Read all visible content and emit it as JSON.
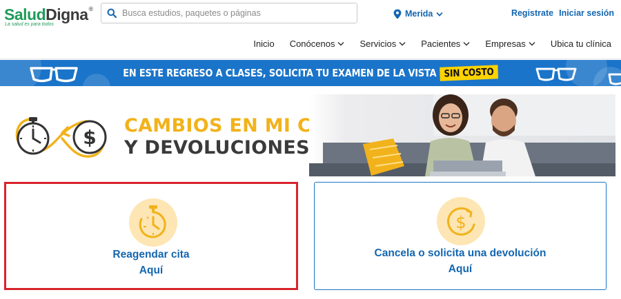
{
  "brand": {
    "name_part1": "Salud",
    "name_part2": "Digna",
    "tagline": "La salud es para todos",
    "green": "#1f9a5a"
  },
  "search": {
    "placeholder": "Busca estudios, paquetes o páginas",
    "value": ""
  },
  "location": {
    "city": "Merida",
    "icon": "location-pin-icon"
  },
  "auth": {
    "register": "Registrate",
    "login": "Iniciar sesión"
  },
  "nav": {
    "items": [
      {
        "label": "Inicio",
        "dropdown": false
      },
      {
        "label": "Conócenos",
        "dropdown": true
      },
      {
        "label": "Servicios",
        "dropdown": true
      },
      {
        "label": "Pacientes",
        "dropdown": true
      },
      {
        "label": "Empresas",
        "dropdown": true
      },
      {
        "label": "Ubica tu clínica",
        "dropdown": false
      }
    ]
  },
  "promo": {
    "text": "EN ESTE REGRESO A CLASES, SOLICITA TU EXAMEN DE LA VISTA",
    "badge": "SIN COSTO",
    "bg_color": "#1a74c9",
    "badge_color": "#ffd300"
  },
  "hero": {
    "title_line1": "CAMBIOS EN MI CITA",
    "title_line2": "Y DEVOLUCIONES",
    "accent_color": "#f2b21b"
  },
  "cards": [
    {
      "line1": "Reagendar cita",
      "line2": "Aquí",
      "icon": "stopwatch-icon",
      "highlight_color": "#d8232a"
    },
    {
      "line1": "Cancela o solicita una devolución",
      "line2": "Aquí",
      "icon": "dollar-coin-icon",
      "border_color": "#1a74c9"
    }
  ],
  "link_color": "#1466b0"
}
